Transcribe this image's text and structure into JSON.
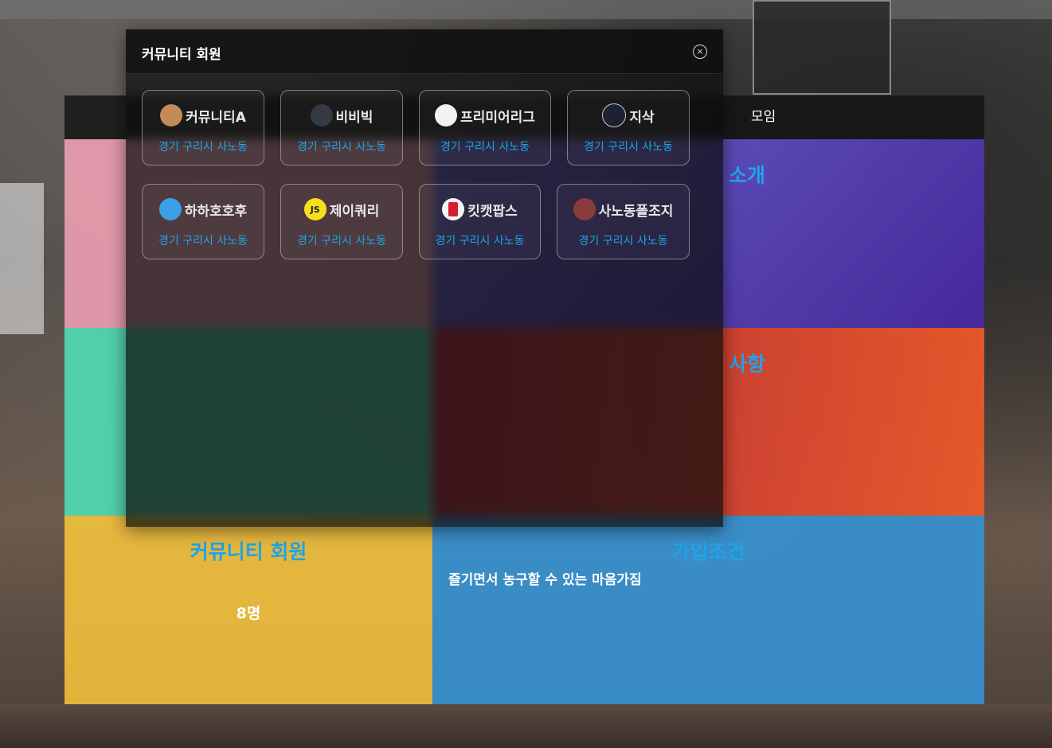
{
  "header": {
    "tab_meeting": "모임"
  },
  "sections": {
    "intro_title": "소개",
    "notice_title": "사항",
    "members_title": "커뮤니티 회원",
    "members_count": "8명",
    "join_title": "가입조건",
    "join_text": "즐기면서 농구할 수 있는 마음가짐"
  },
  "modal": {
    "title": "커뮤니티 회원",
    "close_icon": "close-circle-icon",
    "members": [
      {
        "name": "커뮤니티A",
        "location": "경기 구리시 사노동",
        "avatar_icon": "person-photo-icon",
        "avatar_color": "#c58a5a"
      },
      {
        "name": "비비빅",
        "location": "경기 구리시 사노동",
        "avatar_icon": "dark-photo-icon",
        "avatar_color": "#333a44"
      },
      {
        "name": "프리미어리그",
        "location": "경기 구리시 사노동",
        "avatar_icon": "lion-logo-icon",
        "avatar_color": "#f2f2f2"
      },
      {
        "name": "지삭",
        "location": "경기 구리시 사노동",
        "avatar_icon": "watch-icon",
        "avatar_color": "#1c2233"
      },
      {
        "name": "하하호호후",
        "location": "경기 구리시 사노동",
        "avatar_icon": "doraemon-icon",
        "avatar_color": "#3aa0e8"
      },
      {
        "name": "제이쿼리",
        "location": "경기 구리시 사노동",
        "avatar_icon": "js-logo-icon",
        "avatar_color": "#f7df1e",
        "avatar_text": "JS"
      },
      {
        "name": "킷캣팝스",
        "location": "경기 구리시 사노동",
        "avatar_icon": "kitkat-icon",
        "avatar_color": "#d3202e"
      },
      {
        "name": "사노동폴조지",
        "location": "경기 구리시 사노동",
        "avatar_icon": "person-photo-icon",
        "avatar_color": "#8a3b3b"
      }
    ]
  }
}
